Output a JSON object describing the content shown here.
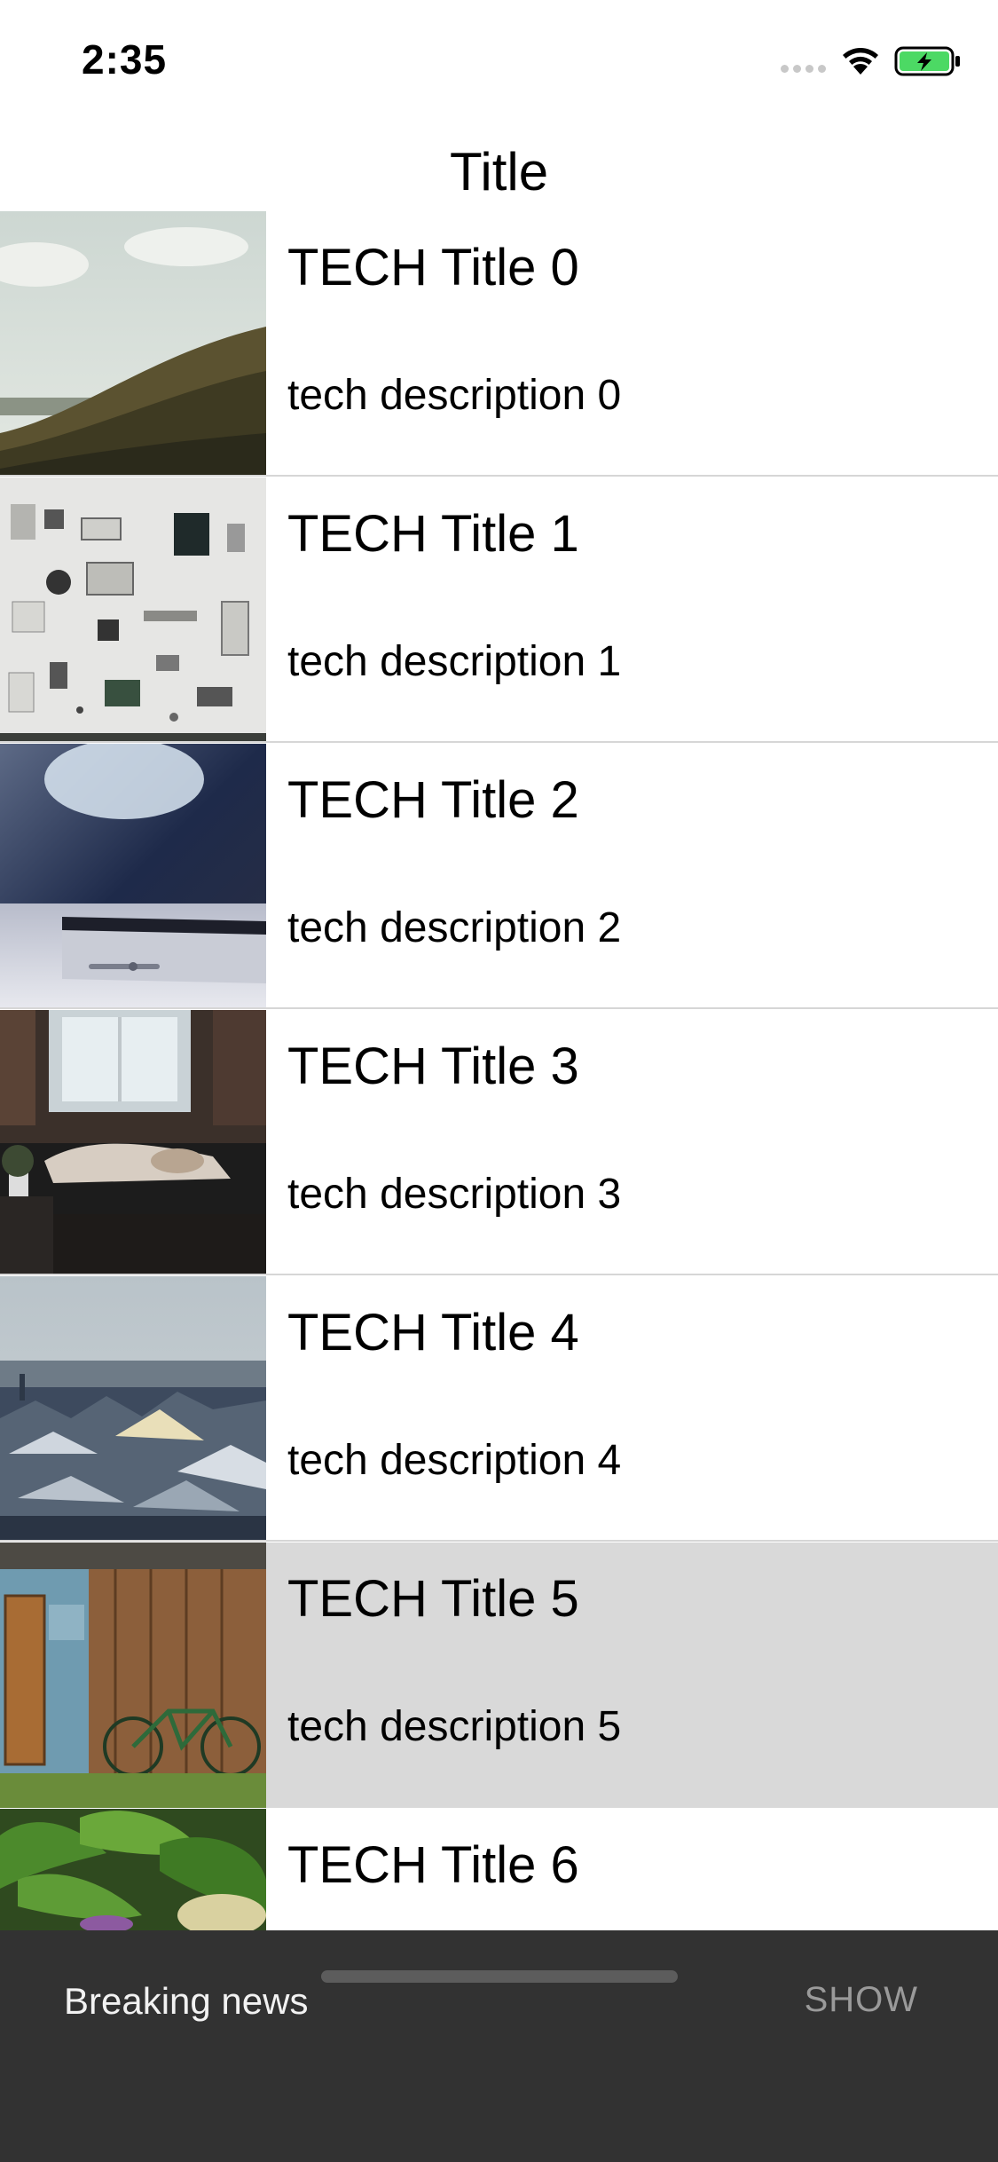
{
  "status_bar": {
    "time": "2:35",
    "signal_icon": "cellular-signal-icon",
    "wifi_icon": "wifi-icon",
    "battery_icon": "battery-charging-icon",
    "battery_color": "#4cd964"
  },
  "nav": {
    "title": "Title"
  },
  "list": {
    "items": [
      {
        "title": "TECH Title 0",
        "description": "tech description 0",
        "image": "hills-landscape-photo"
      },
      {
        "title": "TECH Title 1",
        "description": "tech description 1",
        "image": "disassembled-camera-parts-photo"
      },
      {
        "title": "TECH Title 2",
        "description": "tech description 2",
        "image": "smartphone-closeup-photo"
      },
      {
        "title": "TECH Title 3",
        "description": "tech description 3",
        "image": "person-on-sofa-photo"
      },
      {
        "title": "TECH Title 4",
        "description": "tech description 4",
        "image": "city-rooftops-photo"
      },
      {
        "title": "TECH Title 5",
        "description": "tech description 5",
        "image": "wooden-shed-bicycle-photo",
        "selected": true
      },
      {
        "title": "TECH Title 6",
        "description": "",
        "image": "green-vegetables-photo"
      }
    ],
    "selected_color": "#d9d9d9"
  },
  "snackbar": {
    "message": "Breaking news",
    "action": "SHOW",
    "background": "#323232"
  }
}
